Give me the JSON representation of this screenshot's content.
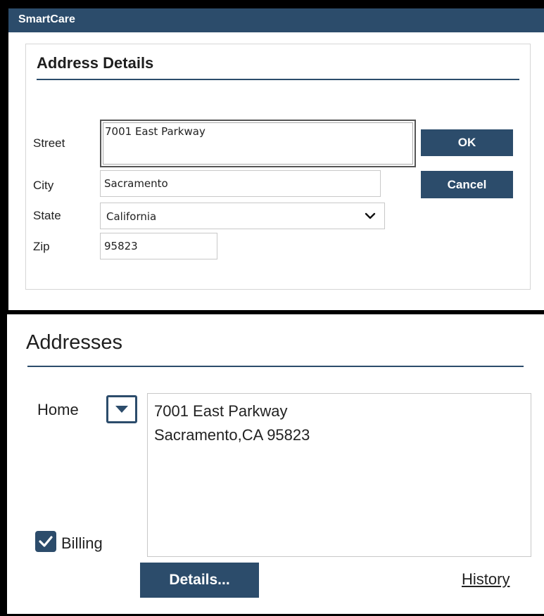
{
  "colors": {
    "accent": "#2c4c6b",
    "frame": "#000000",
    "border": "#c8c8c8",
    "text": "#222222"
  },
  "dialog": {
    "app_title": "SmartCare",
    "heading": "Address Details",
    "fields": {
      "street_label": "Street",
      "street_value": "7001 East Parkway",
      "city_label": "City",
      "city_value": "Sacramento",
      "state_label": "State",
      "state_value": "California",
      "zip_label": "Zip",
      "zip_value": "95823"
    },
    "buttons": {
      "ok": "OK",
      "cancel": "Cancel"
    },
    "icons": {
      "state_dropdown": "chevron-down-icon"
    }
  },
  "addresses": {
    "heading": "Addresses",
    "type_label": "Home",
    "address_lines": [
      "7001 East Parkway",
      "Sacramento,CA 95823"
    ],
    "billing_label": "Billing",
    "billing_checked": true,
    "details_button": "Details...",
    "history_link": "History",
    "icons": {
      "type_dropdown": "caret-down-icon",
      "billing_check": "checkmark-icon"
    }
  }
}
